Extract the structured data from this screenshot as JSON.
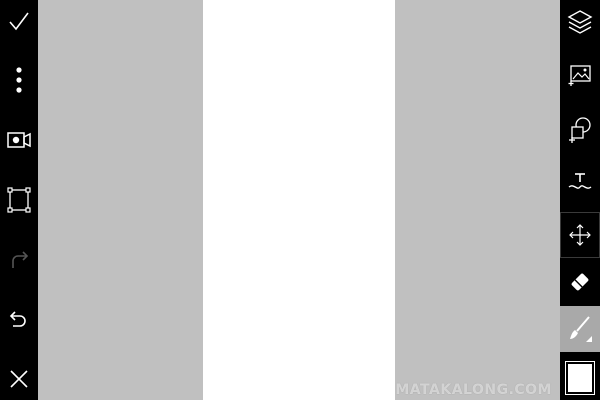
{
  "left_toolbar": {
    "items": [
      {
        "icon": "check-icon"
      },
      {
        "icon": "more-vertical-icon"
      },
      {
        "icon": "video-record-icon"
      },
      {
        "icon": "crop-frame-icon"
      },
      {
        "icon": "redo-icon",
        "disabled": true
      },
      {
        "icon": "undo-icon"
      },
      {
        "icon": "close-icon"
      }
    ]
  },
  "right_toolbar": {
    "items": [
      {
        "icon": "layers-icon"
      },
      {
        "icon": "add-image-icon"
      },
      {
        "icon": "add-shape-icon"
      },
      {
        "icon": "text-icon"
      },
      {
        "icon": "move-icon",
        "selected": true
      },
      {
        "icon": "eraser-icon"
      },
      {
        "icon": "brush-icon",
        "active": true
      }
    ],
    "current_color": "#ffffff"
  },
  "canvas": {
    "columns": [
      "#c0c0c0",
      "#ffffff",
      "#c0c0c0"
    ]
  },
  "watermark": "MATAKALONG.COM"
}
